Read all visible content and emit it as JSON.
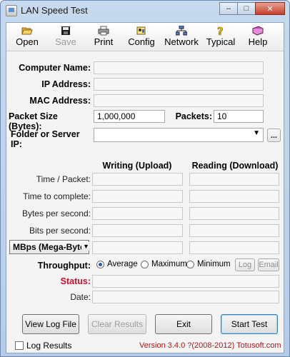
{
  "window": {
    "title": "LAN Speed Test"
  },
  "toolbar": {
    "open": "Open",
    "save": "Save",
    "print": "Print",
    "config": "Config",
    "network": "Network",
    "typical": "Typical",
    "help": "Help"
  },
  "form": {
    "computer_name_label": "Computer Name:",
    "ip_label": "IP Address:",
    "mac_label": "MAC Address:",
    "packet_size_label": "Packet Size (Bytes):",
    "packet_size_value": "1,000,000",
    "packets_label": "Packets:",
    "packets_value": "10",
    "folder_label": "Folder or Server IP:",
    "browse_label": "..."
  },
  "results": {
    "col_writing": "Writing (Upload)",
    "col_reading": "Reading (Download)",
    "rows": [
      "Time / Packet:",
      "Time to complete:",
      "Bytes per second:",
      "Bits per second:"
    ],
    "units_select": "MBps (Mega-Bytes)",
    "throughput_label": "Throughput:",
    "average": "Average",
    "maximum": "Maximum",
    "minimum": "Minimum",
    "log_btn": "Log",
    "email_btn": "Email",
    "status_label": "Status:",
    "date_label": "Date:"
  },
  "buttons": {
    "view_log": "View Log File",
    "clear": "Clear Results",
    "exit": "Exit",
    "start": "Start Test"
  },
  "footer": {
    "log_results": "Log Results",
    "version": "Version 3.4.0  ?(2008-2012) Totusoft.com"
  },
  "colors": {
    "status": "#c8102e",
    "version": "#b01818"
  }
}
